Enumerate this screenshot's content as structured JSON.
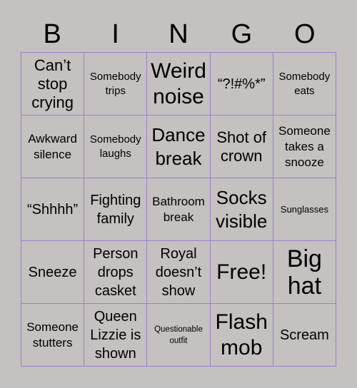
{
  "header": {
    "letters": [
      "B",
      "I",
      "N",
      "G",
      "O"
    ]
  },
  "grid": {
    "line_color": "#9b7fcb",
    "background": "#c4c1c0",
    "cells": [
      [
        "Can’t stop crying",
        "Somebody trips",
        "Weird noise",
        "“?!#%*”",
        "Somebody eats"
      ],
      [
        "Awkward silence",
        "Somebody laughs",
        "Dance break",
        "Shot of crown",
        "Someone takes a snooze"
      ],
      [
        "“Shhhh”",
        "Fighting family",
        "Bathroom break",
        "Socks visible",
        "Sunglasses"
      ],
      [
        "Sneeze",
        "Person drops casket",
        "Royal doesn’t show",
        "Free!",
        "Big hat"
      ],
      [
        "Someone stutters",
        "Queen Lizzie is shown",
        "Questionable outfit",
        "Flash mob",
        "Scream"
      ]
    ]
  }
}
